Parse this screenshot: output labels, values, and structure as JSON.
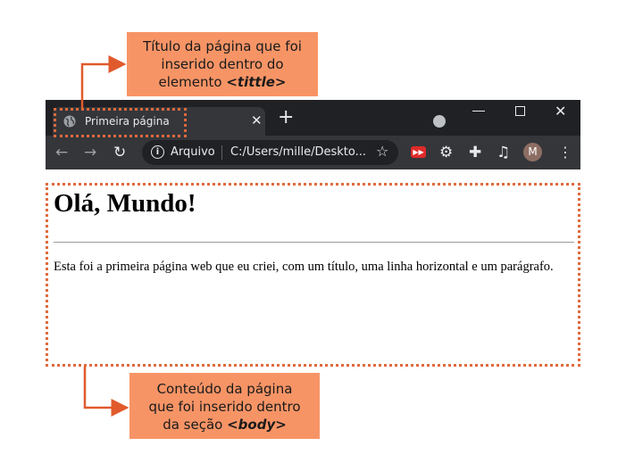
{
  "callouts": {
    "top": {
      "line1": "Título da página que foi",
      "line2": "inserido dentro do",
      "line3_prefix": "elemento ",
      "tag": "<tittle>"
    },
    "bottom": {
      "line1": "Conteúdo da página",
      "line2": "que foi inserido dentro",
      "line3_prefix": "da seção ",
      "tag": "<body>"
    }
  },
  "browser": {
    "tab_title": "Primeira página",
    "tab_close": "✕",
    "new_tab": "+",
    "security_label": "Arquivo",
    "url": "C:/Users/mille/Deskto...",
    "avatar_letter": "M",
    "icons": [
      "back-arrow-icon",
      "forward-arrow-icon",
      "reload-icon",
      "info-icon",
      "star-icon",
      "extension-red-icon",
      "gear-icon",
      "puzzle-icon",
      "media-icon",
      "menu-icon"
    ]
  },
  "page": {
    "heading": "Olá, Mundo!",
    "paragraph": "Esta foi a primeira página web que eu criei, com um título, uma linha horizontal e um parágrafo."
  },
  "colors": {
    "callout_bg": "#f79466",
    "highlight": "#e06a3c",
    "chrome_dark": "#202124",
    "chrome_tab": "#35363a"
  }
}
